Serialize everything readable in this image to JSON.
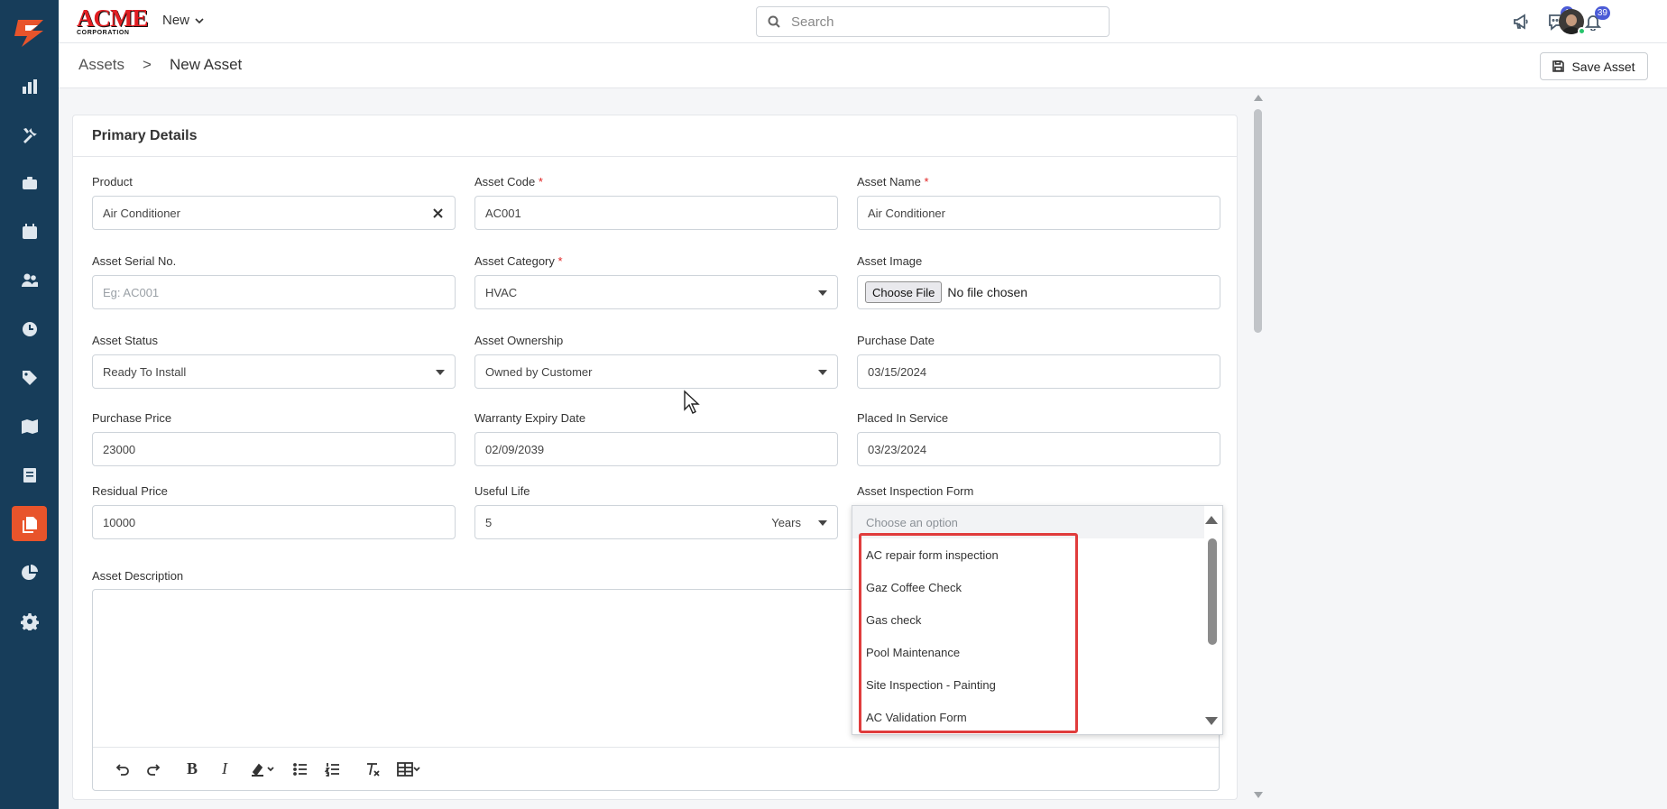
{
  "brand": {
    "logo_text": "ACME",
    "logo_sub": "CORPORATION"
  },
  "topbar": {
    "new_label": "New",
    "search_placeholder": "Search",
    "messages_badge": "1",
    "notifications_badge": "39"
  },
  "breadcrumb": {
    "root": "Assets",
    "separator": ">",
    "current": "New Asset"
  },
  "actions": {
    "save_label": "Save Asset"
  },
  "section": {
    "title": "Primary Details"
  },
  "fields": {
    "product": {
      "label": "Product",
      "value": "Air Conditioner"
    },
    "asset_code": {
      "label": "Asset Code",
      "required": "*",
      "value": "AC001"
    },
    "asset_name": {
      "label": "Asset Name",
      "required": "*",
      "value": "Air Conditioner"
    },
    "serial_no": {
      "label": "Asset Serial No.",
      "placeholder": "Eg: AC001"
    },
    "category": {
      "label": "Asset Category",
      "required": "*",
      "value": "HVAC"
    },
    "image": {
      "label": "Asset Image",
      "button": "Choose File",
      "status": "No file chosen"
    },
    "status": {
      "label": "Asset Status",
      "value": "Ready To Install"
    },
    "ownership": {
      "label": "Asset Ownership",
      "value": "Owned by Customer"
    },
    "purchase_date": {
      "label": "Purchase Date",
      "value": "03/15/2024"
    },
    "purchase_price": {
      "label": "Purchase Price",
      "value": "23000"
    },
    "warranty_expiry": {
      "label": "Warranty Expiry Date",
      "value": "02/09/2039"
    },
    "placed_in_service": {
      "label": "Placed In Service",
      "value": "03/23/2024"
    },
    "residual_price": {
      "label": "Residual Price",
      "value": "10000"
    },
    "useful_life": {
      "label": "Useful Life",
      "value": "5",
      "unit": "Years"
    },
    "inspection_form": {
      "label": "Asset Inspection Form"
    },
    "description": {
      "label": "Asset Description"
    }
  },
  "inspection_dropdown": {
    "placeholder": "Choose an option",
    "options": [
      "AC repair form inspection",
      "Gaz Coffee Check",
      "Gas check",
      "Pool Maintenance",
      "Site Inspection - Painting",
      "AC Validation Form"
    ]
  },
  "colors": {
    "sidebar": "#173d5a",
    "sidebar_active": "#e8542b",
    "highlight": "#e03c3c",
    "badge": "#4b5bd6"
  },
  "icons": {
    "sidebar": [
      "dashboard-chart-icon",
      "tools-icon",
      "briefcase-icon",
      "calendar-icon",
      "users-icon",
      "clock-icon",
      "tag-icon",
      "map-icon",
      "invoice-icon",
      "documents-icon",
      "pie-chart-icon",
      "gear-icon"
    ]
  }
}
